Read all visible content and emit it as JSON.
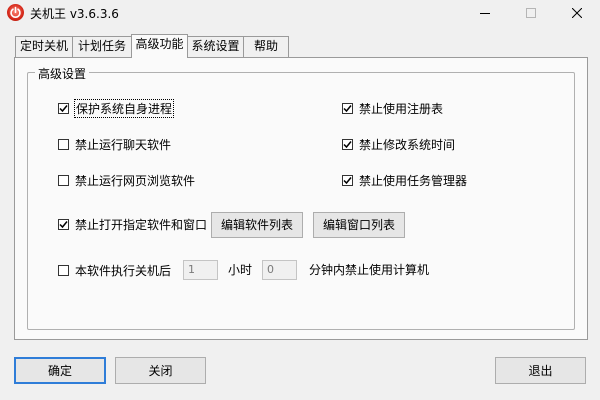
{
  "window": {
    "title": "关机王 v3.6.3.6"
  },
  "tabs": [
    {
      "label": "定时关机"
    },
    {
      "label": "计划任务"
    },
    {
      "label": "高级功能"
    },
    {
      "label": "系统设置"
    },
    {
      "label": "帮助"
    }
  ],
  "group": {
    "title": "高级设置",
    "options": {
      "protect_process": {
        "label": "保护系统自身进程",
        "checked": true
      },
      "disable_registry": {
        "label": "禁止使用注册表",
        "checked": true
      },
      "disable_chat": {
        "label": "禁止运行聊天软件",
        "checked": false
      },
      "disable_time_change": {
        "label": "禁止修改系统时间",
        "checked": true
      },
      "disable_browser": {
        "label": "禁止运行网页浏览软件",
        "checked": false
      },
      "disable_taskmgr": {
        "label": "禁止使用任务管理器",
        "checked": true
      },
      "disable_apps_windows": {
        "label": "禁止打开指定软件和窗口",
        "checked": true
      },
      "after_shutdown": {
        "label": "本软件执行关机后",
        "checked": false
      }
    },
    "edit_software_list": "编辑软件列表",
    "edit_window_list": "编辑窗口列表",
    "hours_value": "1",
    "hours_unit": "小时",
    "minutes_value": "0",
    "minutes_suffix": "分钟内禁止使用计算机"
  },
  "footer": {
    "ok": "确定",
    "close": "关闭",
    "exit": "退出"
  }
}
